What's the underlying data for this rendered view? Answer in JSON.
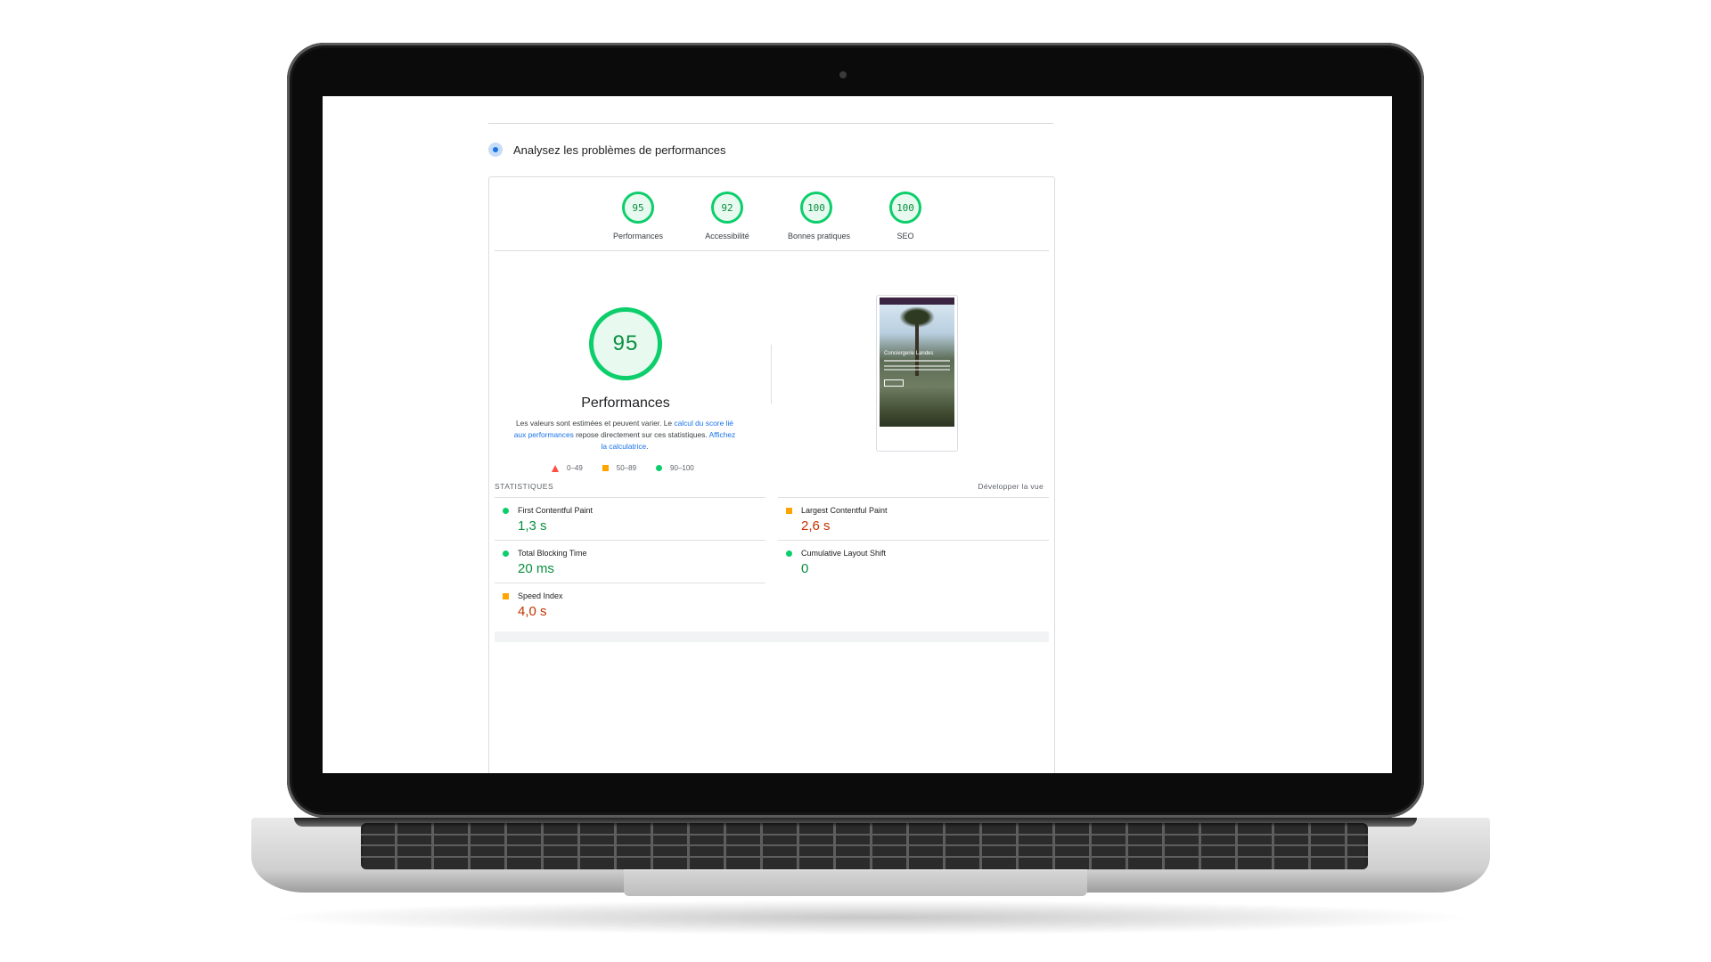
{
  "page": {
    "analyse_title": "Analysez les problèmes de performances"
  },
  "categories": [
    {
      "score": "95",
      "label": "Performances"
    },
    {
      "score": "92",
      "label": "Accessibilité"
    },
    {
      "score": "100",
      "label": "Bonnes pratiques"
    },
    {
      "score": "100",
      "label": "SEO"
    }
  ],
  "summary": {
    "score": "95",
    "title": "Performances",
    "disclaimer_part1": "Les valeurs sont estimées et peuvent varier. Le ",
    "disclaimer_link1": "calcul du score lié aux performances",
    "disclaimer_part2": " repose directement sur ces statistiques. ",
    "disclaimer_link2": "Affichez la calculatrice",
    "disclaimer_part3": "."
  },
  "legend": [
    {
      "range": "0–49",
      "shape": "triangle",
      "color": "#ff4e42"
    },
    {
      "range": "50–89",
      "shape": "square",
      "color": "#ffa400"
    },
    {
      "range": "90–100",
      "shape": "circle",
      "color": "#0cce6b"
    }
  ],
  "screenshot": {
    "site_title": "Conciergerie Landes"
  },
  "stats": {
    "heading": "STATISTIQUES",
    "expand_label": "Développer la vue",
    "metrics": [
      {
        "name": "First Contentful Paint",
        "value": "1,3 s",
        "rating": "good"
      },
      {
        "name": "Largest Contentful Paint",
        "value": "2,6 s",
        "rating": "average"
      },
      {
        "name": "Total Blocking Time",
        "value": "20 ms",
        "rating": "good"
      },
      {
        "name": "Cumulative Layout Shift",
        "value": "0",
        "rating": "good"
      },
      {
        "name": "Speed Index",
        "value": "4,0 s",
        "rating": "average"
      }
    ]
  },
  "colors": {
    "pass": "#0cce6b",
    "average": "#ffa400",
    "fail": "#ff4e42",
    "link": "#1a73e8"
  }
}
